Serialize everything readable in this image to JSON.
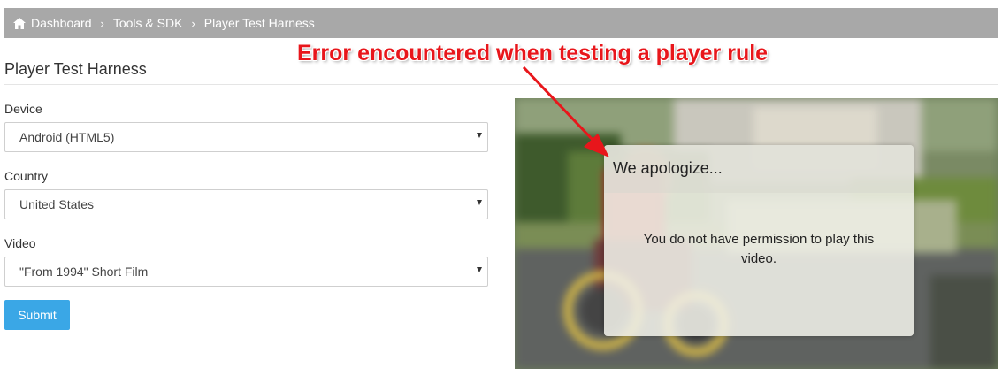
{
  "breadcrumb": {
    "items": [
      {
        "label": "Dashboard",
        "icon": "home-icon"
      },
      {
        "label": "Tools & SDK"
      },
      {
        "label": "Player Test Harness"
      }
    ],
    "separator": "›"
  },
  "page": {
    "title": "Player Test Harness"
  },
  "form": {
    "device": {
      "label": "Device",
      "value": "Android (HTML5)"
    },
    "country": {
      "label": "Country",
      "value": "United States"
    },
    "video": {
      "label": "Video",
      "value": "\"From 1994\" Short Film"
    },
    "submit_label": "Submit"
  },
  "player": {
    "error_title": "We apologize...",
    "error_message": "You do not have permission to play this video."
  },
  "annotation": {
    "text": "Error encountered when testing a player rule",
    "color": "#e8161b"
  },
  "colors": {
    "breadcrumb_bg": "#a8a8a8",
    "submit_bg": "#3aa7e6"
  }
}
